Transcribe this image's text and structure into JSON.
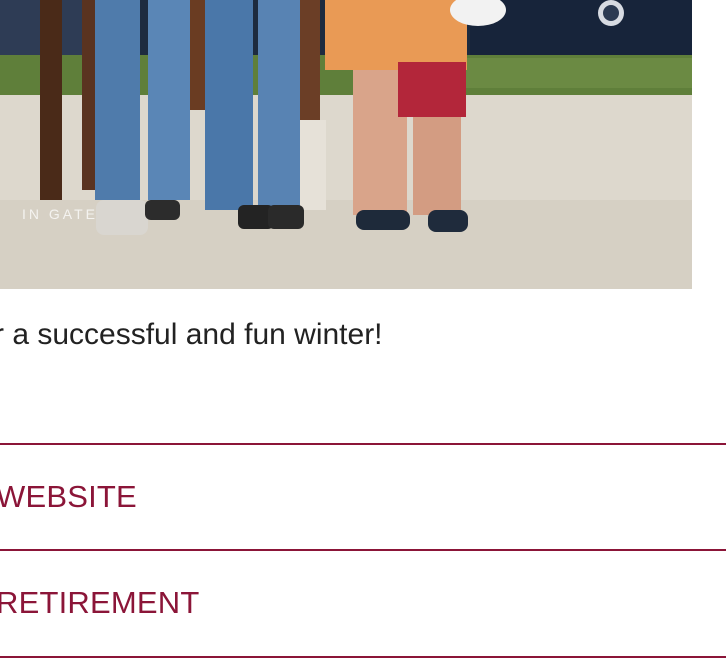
{
  "caption": "r a successful and fun winter!",
  "links": [
    {
      "label": "WEBSITE"
    },
    {
      "label": "RETIREMENT"
    }
  ],
  "colors": {
    "accent": "#8b1538",
    "text": "#222222"
  },
  "photo": {
    "watermark": "IN GATE"
  }
}
